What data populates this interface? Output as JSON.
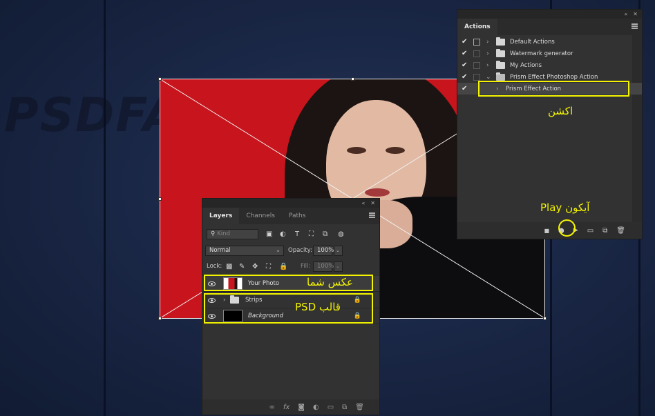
{
  "watermark": "PSDFA.COM",
  "actions_panel": {
    "tab": "Actions",
    "items": [
      {
        "label": "Default Actions",
        "checked": true
      },
      {
        "label": "Watermark generator",
        "checked": true
      },
      {
        "label": "My Actions",
        "checked": true
      },
      {
        "label": "Prism Effect Photoshop Action",
        "checked": true
      },
      {
        "label": "Prism Effect Action",
        "checked": true
      }
    ]
  },
  "layers_panel": {
    "tabs": [
      "Layers",
      "Channels",
      "Paths"
    ],
    "kind_placeholder": "Kind",
    "blend_mode": "Normal",
    "opacity_label": "Opacity:",
    "opacity_value": "100%",
    "lock_label": "Lock:",
    "fill_label": "Fill:",
    "fill_value": "100%",
    "layers": [
      {
        "name": "Your Photo"
      },
      {
        "name": "Strips"
      },
      {
        "name": "Background"
      }
    ]
  },
  "annotations": {
    "action_label": "اکشن",
    "play_label": "آیکون Play",
    "photo_label": "عکس شما",
    "template_label": "قالب PSD"
  },
  "colors": {
    "highlight": "#f4f400",
    "panel_bg": "#323232",
    "photo_bg": "#c8151d"
  }
}
